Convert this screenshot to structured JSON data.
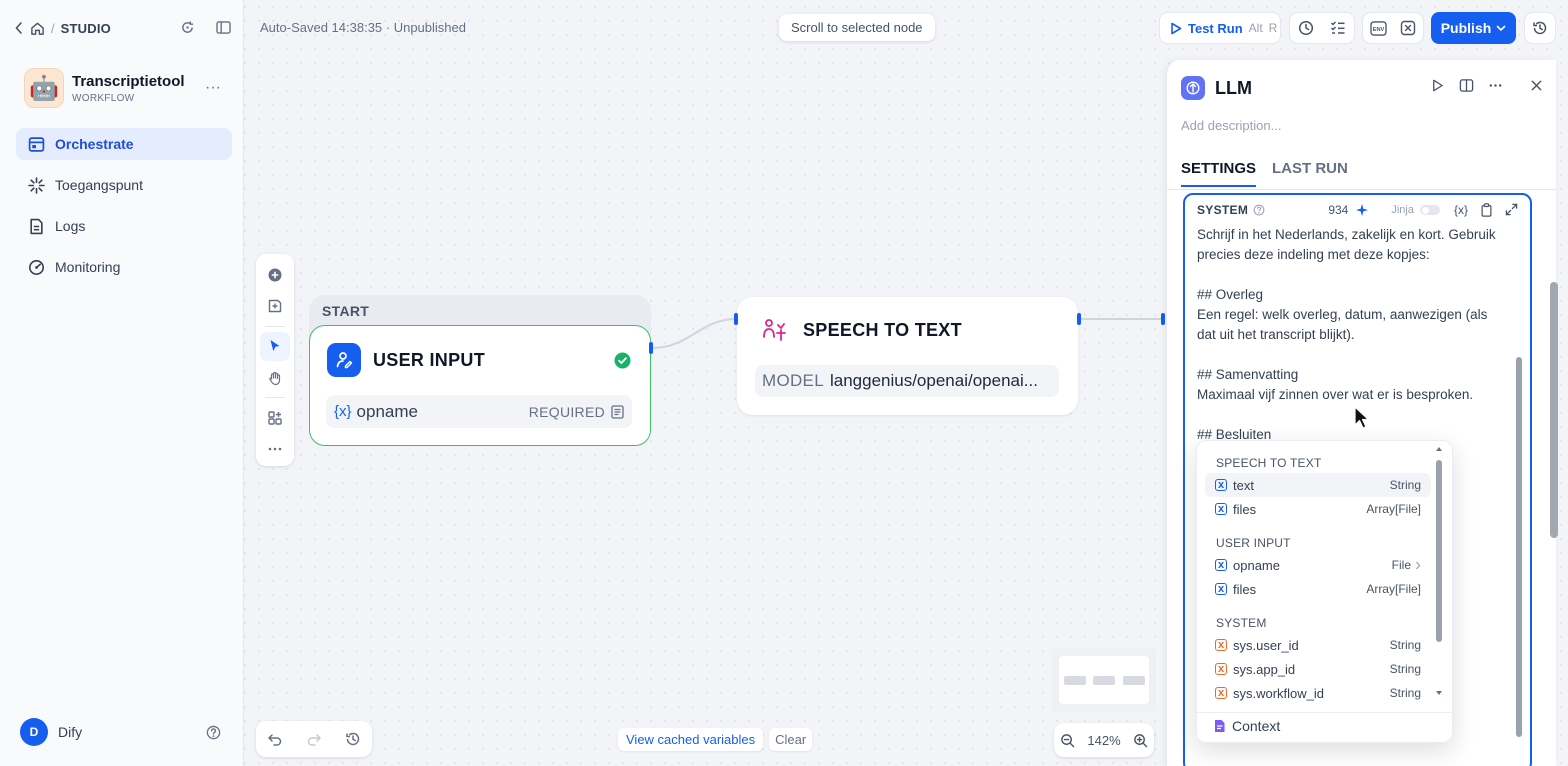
{
  "breadcrumb": {
    "label": "STUDIO"
  },
  "app": {
    "name": "Transcriptietool",
    "kind": "WORKFLOW",
    "emoji": "🤖"
  },
  "nav": [
    {
      "label": "Orchestrate",
      "active": true
    },
    {
      "label": "Toegangspunt"
    },
    {
      "label": "Logs"
    },
    {
      "label": "Monitoring"
    }
  ],
  "user": {
    "initial": "D",
    "name": "Dify"
  },
  "topbar": {
    "autosave": "Auto-Saved 14:38:35 · Unpublished",
    "scroll_to_selected": "Scroll to selected node",
    "test_run": "Test Run",
    "test_run_key1": "Alt",
    "test_run_key2": "R",
    "publish": "Publish",
    "env_label": "ENV"
  },
  "nodes": {
    "start_label": "START",
    "user_input": {
      "title": "USER INPUT",
      "var_name": "opname",
      "var_required": "REQUIRED"
    },
    "speech_to_text": {
      "title": "SPEECH TO TEXT",
      "model_label": "MODEL",
      "model_value": "langgenius/openai/openai..."
    }
  },
  "bottom": {
    "view_cached": "View cached variables",
    "clear": "Clear",
    "zoom": "142%"
  },
  "panel": {
    "title": "LLM",
    "description_placeholder": "Add description...",
    "tabs": [
      {
        "label": "SETTINGS",
        "active": true
      },
      {
        "label": "LAST RUN"
      }
    ],
    "editor": {
      "label": "SYSTEM",
      "count": "934",
      "jinja": "Jinja",
      "lines": [
        "Schrijf in het Nederlands, zakelijk en kort. Gebruik",
        "precies deze indeling met deze kopjes:",
        "",
        "## Overleg",
        "Een regel: welk overleg, datum, aanwezigen (als",
        "dat uit het transcript blijkt).",
        "",
        "## Samenvatting",
        "Maximaal vijf zinnen over wat er is besproken.",
        "",
        "## Besluiten"
      ]
    }
  },
  "dropdown": {
    "groups": [
      {
        "title": "SPEECH TO TEXT",
        "items": [
          {
            "name": "text",
            "type": "String",
            "highlighted": true
          },
          {
            "name": "files",
            "type": "Array[File]"
          }
        ]
      },
      {
        "title": "USER INPUT",
        "items": [
          {
            "name": "opname",
            "type": "File"
          },
          {
            "name": "files",
            "type": "Array[File]"
          }
        ]
      },
      {
        "title": "SYSTEM",
        "items": [
          {
            "name": "sys.user_id",
            "type": "String",
            "system": true
          },
          {
            "name": "sys.app_id",
            "type": "String",
            "system": true
          },
          {
            "name": "sys.workflow_id",
            "type": "String",
            "system": true
          }
        ]
      }
    ],
    "context": "Context"
  }
}
